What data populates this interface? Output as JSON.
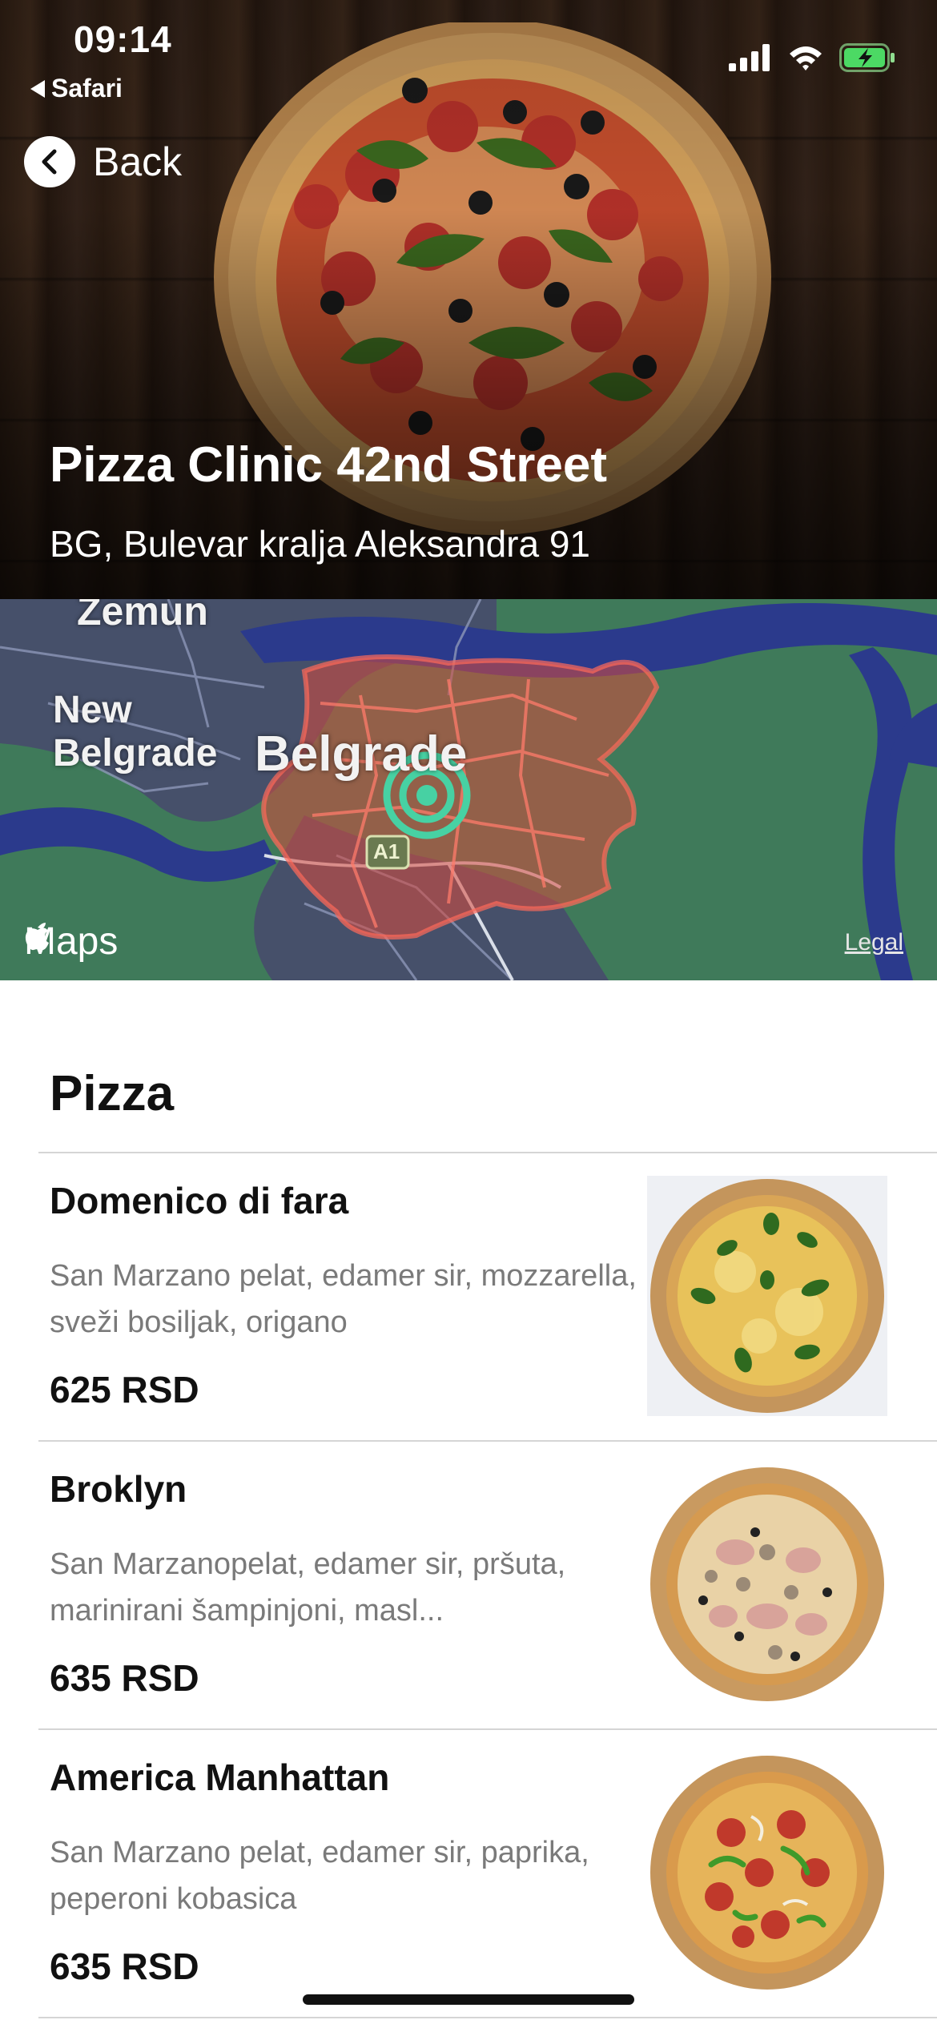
{
  "status_bar": {
    "time": "09:14",
    "back_app": "Safari",
    "icons": [
      "cellular-signal-icon",
      "wifi-icon",
      "battery-charging-icon"
    ]
  },
  "header": {
    "back_label": "Back",
    "restaurant_name": "Pizza Clinic 42nd Street",
    "address": "BG, Bulevar kralja Aleksandra 91"
  },
  "map": {
    "labels": {
      "zemun": "Zemun",
      "new_belgrade": "New Belgrade",
      "belgrade": "Belgrade",
      "road": "A1"
    },
    "brand": "Maps",
    "legal": "Legal",
    "colors": {
      "land": "#3f7a5a",
      "water": "#2b3a8c",
      "delivery_area": "#d94a3c",
      "pin": "#47d1a3"
    }
  },
  "menu": {
    "section_title": "Pizza",
    "items": [
      {
        "name": "Domenico di fara",
        "description": "San Marzano pelat, edamer sir, mozzarella, sveži bosiljak, origano",
        "price": "625 RSD"
      },
      {
        "name": "Broklyn",
        "description": "San Marzanopelat, edamer sir, pršuta, marinirani šampinjoni, masl...",
        "price": "635 RSD"
      },
      {
        "name": "America Manhattan",
        "description": "San Marzano pelat, edamer sir, paprika, peperoni kobasica",
        "price": "635 RSD"
      }
    ]
  }
}
